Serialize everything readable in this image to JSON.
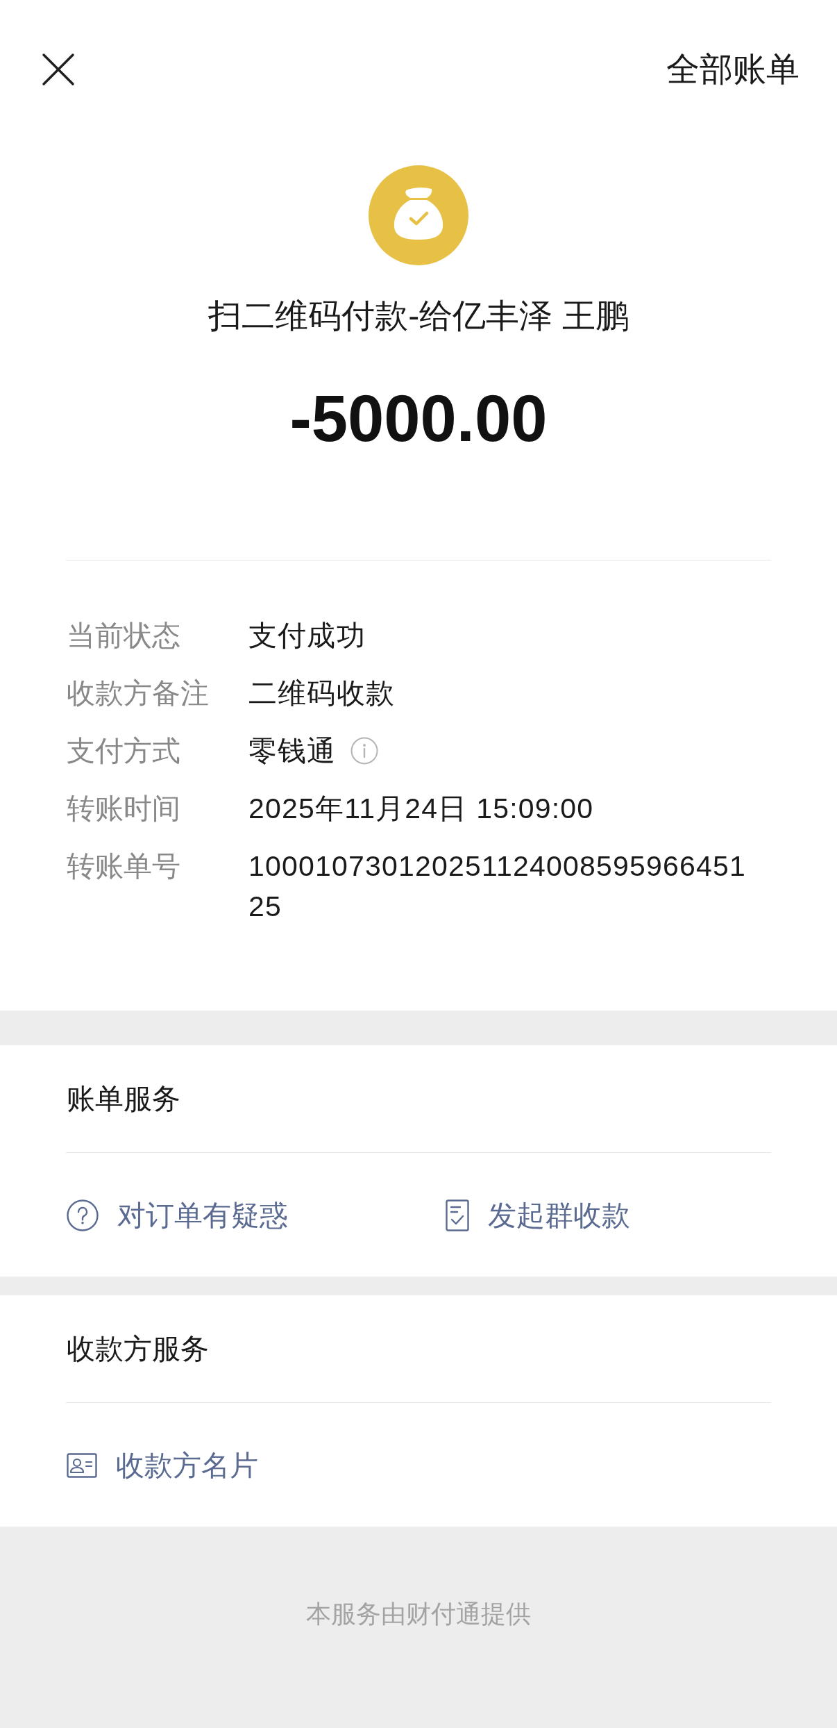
{
  "header": {
    "action": "全部账单"
  },
  "summary": {
    "title": "扫二维码付款-给亿丰泽 王鹏",
    "amount": "-5000.00"
  },
  "details": [
    {
      "label": "当前状态",
      "value": "支付成功",
      "kind": "plain"
    },
    {
      "label": "收款方备注",
      "value": "二维码收款",
      "kind": "plain"
    },
    {
      "label": "支付方式",
      "value": "零钱通",
      "kind": "info"
    },
    {
      "label": "转账时间",
      "value": "2025年11月24日 15:09:00",
      "kind": "plain"
    },
    {
      "label": "转账单号",
      "value": "10001073012025112400859596645125",
      "kind": "plain"
    }
  ],
  "bill_services": {
    "title": "账单服务",
    "actions": [
      {
        "label": "对订单有疑惑",
        "kind": "inquiry"
      },
      {
        "label": "发起群收款",
        "kind": "collect"
      }
    ]
  },
  "payee_services": {
    "title": "收款方服务",
    "actions": [
      {
        "label": "收款方名片",
        "kind": "profile"
      }
    ]
  },
  "footer": {
    "text": "本服务由财付通提供"
  }
}
